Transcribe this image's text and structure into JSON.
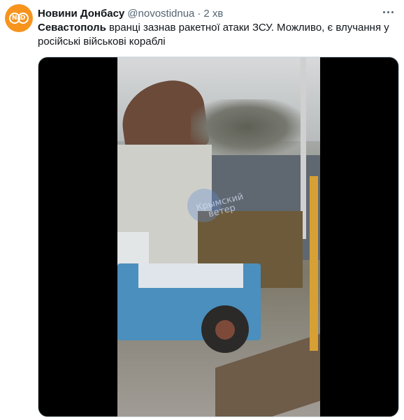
{
  "tweet": {
    "display_name": "Новини Донбасу",
    "handle": "@novostidnua",
    "separator": "·",
    "time": "2 хв",
    "text_bold": "Севастополь",
    "text_rest": " вранці зазнав ракетної атаки ЗСУ. Можливо, є влучання у російські військові кораблі",
    "avatar_letters": [
      "N",
      "D"
    ],
    "more_icon": "more-horizontal-icon"
  },
  "media": {
    "watermark_line1": "Крымский",
    "watermark_line2": "ветер"
  },
  "colors": {
    "avatar_bg": "#f7941d",
    "text_primary": "#0f1419",
    "text_secondary": "#536471",
    "media_bg": "#000000"
  }
}
